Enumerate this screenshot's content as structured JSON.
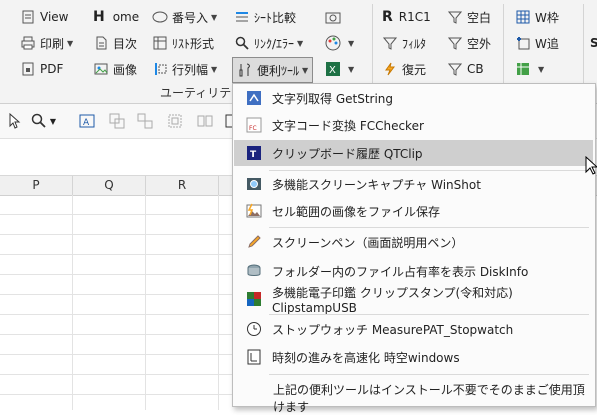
{
  "ribbon": {
    "col1": [
      "View",
      "印刷",
      "PDF"
    ],
    "col2": [
      "ome",
      "目次",
      "画像"
    ],
    "col2_h": "H",
    "col3": [
      "番号入",
      "ﾘｽﾄ形式",
      "行列幅"
    ],
    "col4": [
      "ｼｰﾄ比較",
      "ﾘﾝｸ/ｴﾗｰ",
      "便利ﾂｰﾙ"
    ],
    "col6": [
      "R1C1",
      "ﾌｨﾙﾀ",
      "復元"
    ],
    "col6_r": "R",
    "col7": [
      "空白",
      "空外",
      "CB"
    ],
    "col8": [
      "W枠",
      "W追"
    ],
    "col9": "S",
    "group_label": "ユーティリティ"
  },
  "sheet": {
    "columns": [
      "P",
      "Q",
      "R"
    ]
  },
  "menu": {
    "items": [
      {
        "label": "文字列取得 GetString",
        "icon": "getstring-icon"
      },
      {
        "label": "文字コード変換 FCChecker",
        "icon": "fcchecker-icon"
      },
      {
        "label": "クリップボード履歴 QTClip",
        "icon": "qtclip-icon"
      },
      {
        "label": "多機能スクリーンキャプチャ WinShot",
        "icon": "camera-icon"
      },
      {
        "label": "セル範囲の画像をファイル保存",
        "icon": "image-save-icon"
      },
      {
        "label": "スクリーンペン（画面説明用ペン）",
        "icon": "pen-icon"
      },
      {
        "label": "フォルダー内のファイル占有率を表示 DiskInfo",
        "icon": "diskinfo-icon"
      },
      {
        "label": "多機能電子印鑑 クリップスタンプ(令和対応) ClipstampUSB",
        "icon": "stamp-icon"
      },
      {
        "label": "ストップウォッチ MeasurePAT_Stopwatch",
        "icon": "stopwatch-icon"
      },
      {
        "label": "時刻の進みを高速化 時空windows",
        "icon": "clock-icon"
      }
    ],
    "footer": "上記の便利ツールはインストール不要でそのままご使用頂けます",
    "selected": "クリップボード履歴 QTClip"
  },
  "colors": {
    "selected_bg": "#cfcfcf",
    "excel_green": "#1e7145"
  }
}
